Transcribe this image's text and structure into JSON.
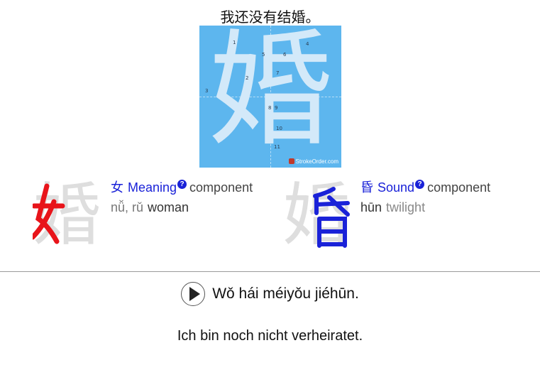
{
  "sentence": {
    "chinese": "我还没有结婚。",
    "pinyin": "Wǒ hái méiyǒu jiéhūn.",
    "translation": "Ich bin noch nicht verheiratet."
  },
  "stroke_order": {
    "character": "婚",
    "brand": "StrokeOrder.com",
    "numbers": [
      "1",
      "2",
      "3",
      "4",
      "5",
      "6",
      "7",
      "8",
      "9",
      "10",
      "11"
    ]
  },
  "components": [
    {
      "character": "婚",
      "highlight": "女",
      "highlight_color": "#e8141a",
      "radical": "女",
      "role": "Meaning",
      "suffix": "component",
      "pinyin": "nǚ, rǔ",
      "meaning": "woman"
    },
    {
      "character": "婚",
      "highlight": "昏",
      "highlight_color": "#1a22d8",
      "radical": "昏",
      "role": "Sound",
      "suffix": "component",
      "pinyin": "hūn",
      "meaning": "twilight"
    }
  ],
  "help_glyph": "?",
  "colors": {
    "stroke_bg": "#5db6ee",
    "accent_blue": "#1a22d8",
    "accent_red": "#e8141a"
  }
}
